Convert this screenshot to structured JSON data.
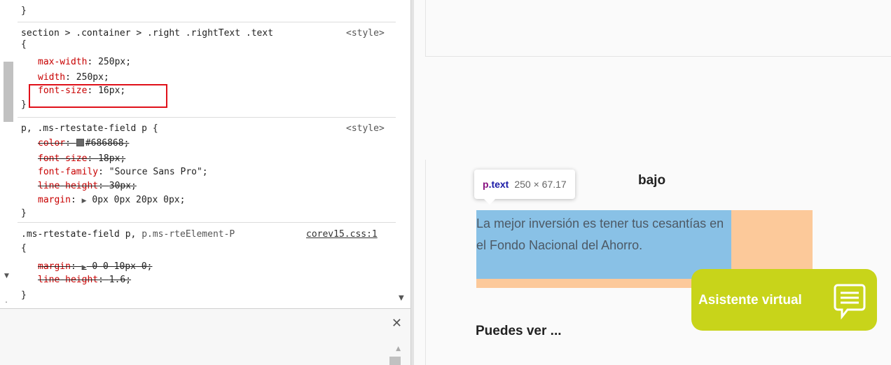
{
  "devtools": {
    "rules": [
      {
        "closing": "}"
      },
      {
        "selector": "section > .container > .right .rightText .text",
        "source": "<style>",
        "open": "{",
        "declarations": [
          {
            "prop": "max-width",
            "value": "250px;"
          },
          {
            "prop": "width",
            "value": "250px;"
          },
          {
            "prop": "font-size",
            "value": "16px;"
          }
        ],
        "close": "}"
      },
      {
        "selector": "p, .ms-rtestate-field p {",
        "source": "<style>",
        "declarations": [
          {
            "prop": "color",
            "value": "#686868;",
            "swatch": "#686868"
          },
          {
            "prop": "font-size",
            "value": "18px;"
          },
          {
            "prop": "font-family",
            "value": "\"Source Sans Pro\";"
          },
          {
            "prop": "line-height",
            "value": "30px;"
          },
          {
            "prop": "margin",
            "value": "0px 0px 20px 0px;"
          }
        ],
        "close": "}"
      },
      {
        "selector": ".ms-rtestate-field p,",
        "selector_dim": " p.ms-rteElement-P",
        "source": "corev15.css:1",
        "open": "{",
        "declarations": [
          {
            "prop": "margin",
            "value": "0 0 10px 0;"
          },
          {
            "prop": "line-height",
            "value": "1.6;"
          }
        ],
        "close": "}"
      }
    ],
    "drawer": {
      "close": "✕"
    }
  },
  "webpage": {
    "heading_visible_tail": "bajo",
    "paragraph": "La mejor inversión es tener tus cesantías en el Fondo Nacional del Ahorro.",
    "tooltip": {
      "tag": "p",
      "class": ".text",
      "dimensions": "250 × 67.17"
    },
    "assistant_label": "Asistente virtual",
    "heading2": "Puedes ver ...",
    "colors": {
      "assistant_bg": "#c8d41a",
      "content_overlay": "#89c1e6",
      "margin_overlay": "#fcc99a",
      "highlight_border": "#e0111a"
    }
  }
}
